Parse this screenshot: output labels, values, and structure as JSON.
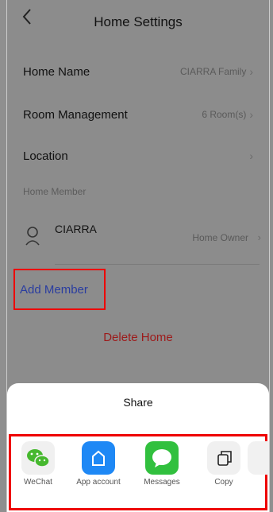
{
  "header": {
    "title": "Home Settings",
    "back_icon": "chevron-left-icon"
  },
  "settings": {
    "home_name_label": "Home Name",
    "home_name_value": "CIARRA Family",
    "room_label": "Room Management",
    "room_value": "6 Room(s)",
    "location_label": "Location",
    "location_value": ""
  },
  "members": {
    "section_label": "Home Member",
    "items": [
      {
        "name": "CIARRA",
        "role": "Home Owner"
      }
    ]
  },
  "actions": {
    "add_member": "Add Member",
    "delete_home": "Delete Home"
  },
  "share_sheet": {
    "title": "Share",
    "items": [
      {
        "label": "WeChat",
        "icon": "wechat-icon"
      },
      {
        "label": "App account",
        "icon": "home-app-icon"
      },
      {
        "label": "Messages",
        "icon": "messages-icon"
      },
      {
        "label": "Copy",
        "icon": "copy-icon"
      }
    ]
  },
  "colors": {
    "accent_blue": "#2a3da0",
    "danger_red": "#9d1a1a",
    "highlight_red": "#e00000",
    "wechat_green": "#46b82e",
    "messages_green": "#31c03e",
    "app_blue": "#1e88f5"
  }
}
